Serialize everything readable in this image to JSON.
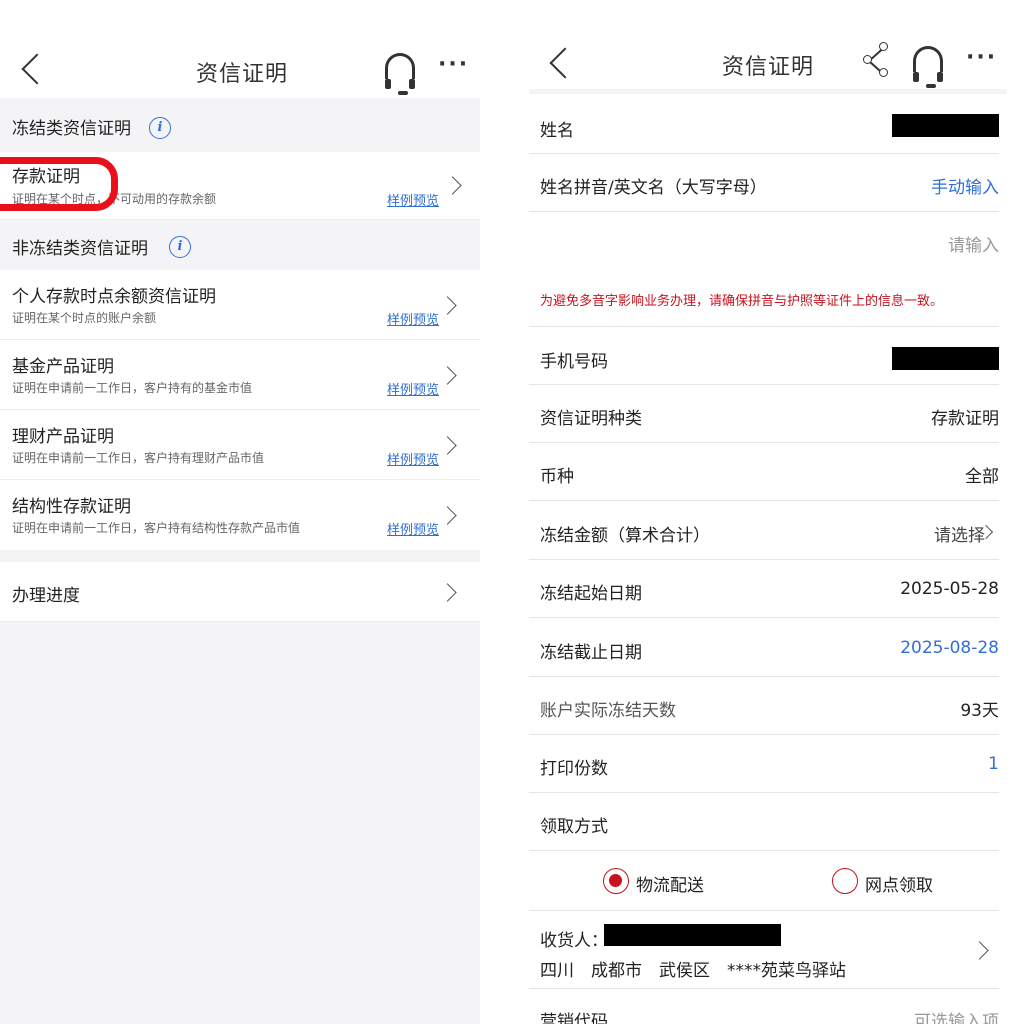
{
  "left": {
    "title": "资信证明",
    "frozen_section": "冻结类资信证明",
    "nonfrozen_section": "非冻结类资信证明",
    "items": [
      {
        "title": "存款证明",
        "sub": "证明在某个时点，不可动用的存款余额",
        "sample": "样例预览"
      },
      {
        "title": "个人存款时点余额资信证明",
        "sub": "证明在某个时点的账户余额",
        "sample": "样例预览"
      },
      {
        "title": "基金产品证明",
        "sub": "证明在申请前一工作日，客户持有的基金市值",
        "sample": "样例预览"
      },
      {
        "title": "理财产品证明",
        "sub": "证明在申请前一工作日，客户持有理财产品市值",
        "sample": "样例预览"
      },
      {
        "title": "结构性存款证明",
        "sub": "证明在申请前一工作日，客户持有结构性存款产品市值",
        "sample": "样例预览"
      }
    ],
    "progress": "办理进度",
    "info_glyph": "i"
  },
  "right": {
    "title": "资信证明",
    "fields": {
      "name": {
        "label": "姓名"
      },
      "pinyin": {
        "label": "姓名拼音/英文名（大写字母）",
        "value": "手动输入"
      },
      "pinyin_input": {
        "placeholder": "请输入"
      },
      "warning": "为避免多音字影响业务办理，请确保拼音与护照等证件上的信息一致。",
      "phone": {
        "label": "手机号码"
      },
      "type": {
        "label": "资信证明种类",
        "value": "存款证明"
      },
      "currency": {
        "label": "币种",
        "value": "全部"
      },
      "amount": {
        "label": "冻结金额（算术合计）",
        "value": "请选择"
      },
      "start": {
        "label": "冻结起始日期",
        "value": "2025-05-28"
      },
      "end": {
        "label": "冻结截止日期",
        "value": "2025-08-28"
      },
      "days": {
        "label": "账户实际冻结天数",
        "value": "93天"
      },
      "copies": {
        "label": "打印份数",
        "value": "1"
      },
      "pickup": {
        "label": "领取方式"
      },
      "opt_delivery": "物流配送",
      "opt_branch": "网点领取",
      "receiver_label": "收货人：",
      "address": "四川　成都市　武侯区　****苑菜鸟驿站",
      "marketing": {
        "label": "营销代码",
        "placeholder": "可选输入项"
      }
    }
  },
  "colors": {
    "accent_blue": "#2f6fd6",
    "warning_red": "#c8121e",
    "highlight_red": "#e8101a"
  }
}
